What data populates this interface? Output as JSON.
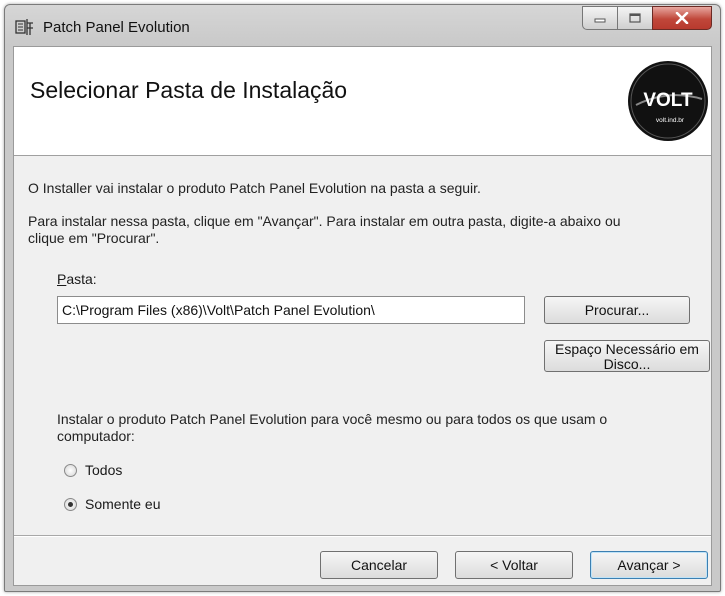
{
  "window": {
    "title": "Patch Panel Evolution",
    "icon": "installer-app-icon"
  },
  "header": {
    "title": "Selecionar Pasta de Instalação",
    "logo_text": "VOLT",
    "logo_url": "volt.ind.br"
  },
  "body": {
    "intro": "O Installer vai instalar o produto Patch Panel Evolution na pasta a seguir.",
    "instructions_line1": "Para instalar nessa pasta, clique em \"Avançar\". Para instalar em outra pasta, digite-a abaixo ou",
    "instructions_line2": "clique em \"Procurar\".",
    "folder_label_underlined": "P",
    "folder_label_rest": "asta:",
    "folder_value": "C:\\Program Files (x86)\\Volt\\Patch Panel Evolution\\",
    "browse_button": "Procurar...",
    "disk_space_button_line1": "Espaço Necessário em",
    "disk_space_button_line2": "Disco...",
    "scope_question_line1": "Instalar o produto Patch Panel Evolution para você mesmo ou para todos os que usam o",
    "scope_question_line2": "computador:",
    "options": [
      {
        "label": "Todos",
        "selected": false
      },
      {
        "label": "Somente eu",
        "selected": true
      }
    ]
  },
  "footer": {
    "cancel": "Cancelar",
    "back": "< Voltar",
    "next": "Avançar >"
  },
  "colors": {
    "close_button": "#c0473a",
    "dialog_background": "#f0f0f0",
    "logo_background": "#111111"
  }
}
